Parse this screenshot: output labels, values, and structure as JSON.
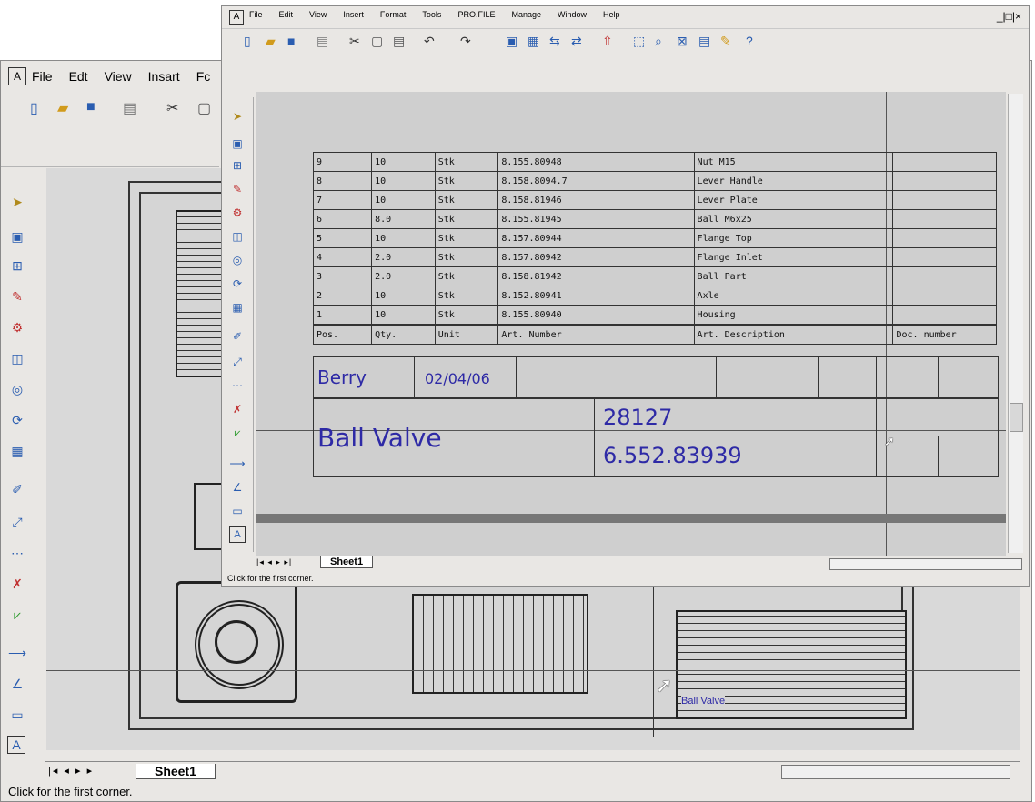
{
  "back_window": {
    "menu": [
      "File",
      "Edt",
      "View",
      "Insart",
      "Fc"
    ],
    "sheet_tab": "Sheet1",
    "status": "Click for the first corner.",
    "title_block": {
      "name": "Ball Valve"
    }
  },
  "front_window": {
    "menu": [
      "File",
      "Edit",
      "View",
      "Insert",
      "Format",
      "Tools",
      "PRO.FILE",
      "Manage",
      "Window",
      "Help"
    ],
    "window_controls": "_|□|×",
    "sheet_tab": "Sheet1",
    "status": "Click for the first corner.",
    "bom": {
      "rows": [
        {
          "pos": "9",
          "qty": "10",
          "unit": "Stk",
          "art": "8.155.80948",
          "desc": "Nut M15",
          "doc": ""
        },
        {
          "pos": "8",
          "qty": "10",
          "unit": "Stk",
          "art": "8.158.8094.7",
          "desc": "Lever Handle",
          "doc": ""
        },
        {
          "pos": "7",
          "qty": "10",
          "unit": "Stk",
          "art": "8.158.81946",
          "desc": "Lever Plate",
          "doc": ""
        },
        {
          "pos": "6",
          "qty": "8.0",
          "unit": "Stk",
          "art": "8.155.81945",
          "desc": "Ball M6x25",
          "doc": ""
        },
        {
          "pos": "5",
          "qty": "10",
          "unit": "Stk",
          "art": "8.157.80944",
          "desc": "Flange Top",
          "doc": ""
        },
        {
          "pos": "4",
          "qty": "2.0",
          "unit": "Stk",
          "art": "8.157.80942",
          "desc": "Flange Inlet",
          "doc": ""
        },
        {
          "pos": "3",
          "qty": "2.0",
          "unit": "Stk",
          "art": "8.158.81942",
          "desc": "Ball Part",
          "doc": ""
        },
        {
          "pos": "2",
          "qty": "10",
          "unit": "Stk",
          "art": "8.152.80941",
          "desc": "Axle",
          "doc": ""
        },
        {
          "pos": "1",
          "qty": "10",
          "unit": "Stk",
          "art": "8.155.80940",
          "desc": "Housing",
          "doc": ""
        }
      ],
      "header": {
        "pos": "Pos.",
        "qty": "Qty.",
        "unit": "Unit",
        "art": "Art. Number",
        "desc": "Art. Description",
        "doc": "Doc. number"
      }
    },
    "title_block": {
      "author": "Berry",
      "date": "02/04/06",
      "name": "Ball Valve",
      "number": "28127",
      "code": "6.552.83939"
    }
  },
  "colors": {
    "handwriting": "#2e2aa6",
    "icon_blue": "#2a5db0"
  }
}
